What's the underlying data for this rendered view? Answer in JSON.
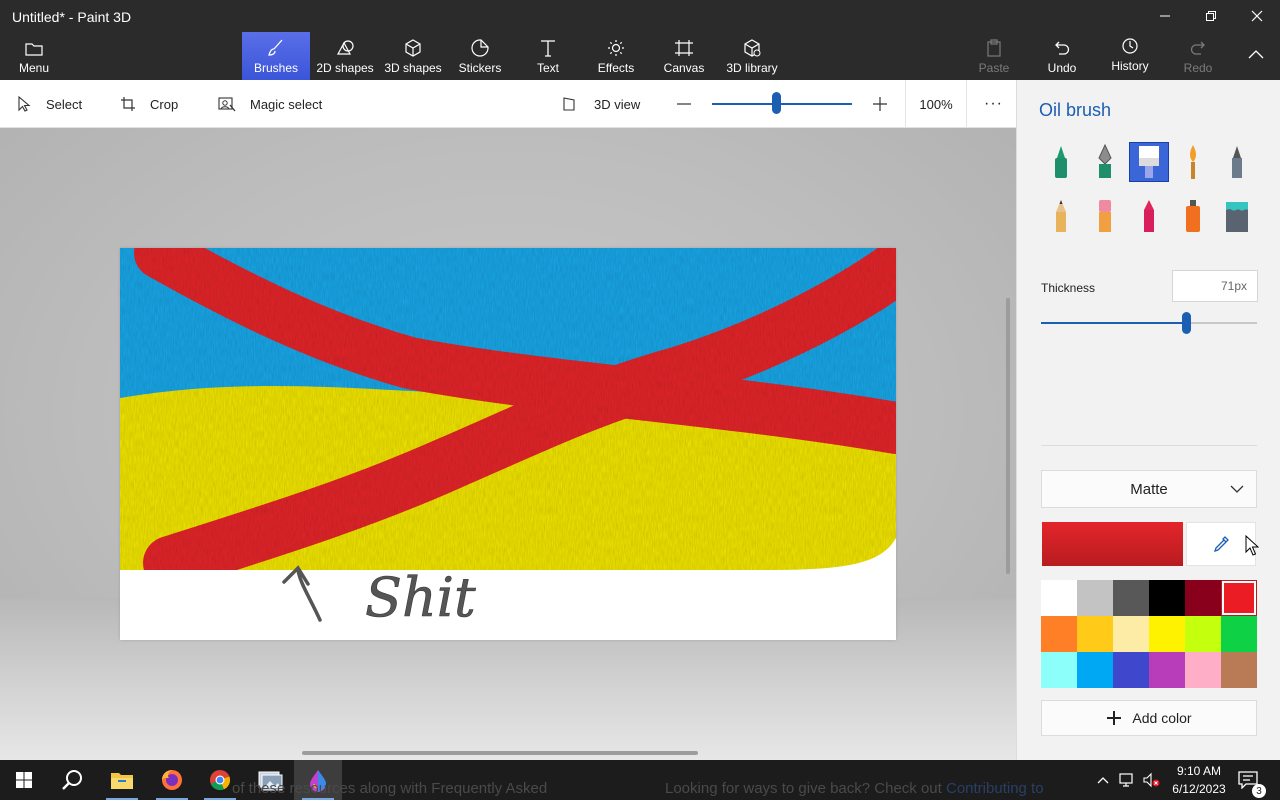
{
  "window": {
    "title": "Untitled* - Paint 3D",
    "minimize_icon": "minimize-icon",
    "maximize_icon": "restore-icon",
    "close_icon": "close-icon"
  },
  "ribbon": {
    "menu_label": "Menu",
    "tabs": [
      {
        "label": "Brushes",
        "icon": "brush-icon",
        "active": true
      },
      {
        "label": "2D shapes",
        "icon": "2d-shapes-icon"
      },
      {
        "label": "3D shapes",
        "icon": "cube-icon"
      },
      {
        "label": "Stickers",
        "icon": "sticker-icon"
      },
      {
        "label": "Text",
        "icon": "text-icon"
      },
      {
        "label": "Effects",
        "icon": "sun-icon"
      },
      {
        "label": "Canvas",
        "icon": "canvas-icon"
      },
      {
        "label": "3D library",
        "icon": "library-icon"
      }
    ],
    "actions": [
      {
        "label": "Paste",
        "icon": "paste-icon",
        "enabled": false
      },
      {
        "label": "Undo",
        "icon": "undo-icon",
        "enabled": true
      },
      {
        "label": "History",
        "icon": "history-icon",
        "enabled": true
      },
      {
        "label": "Redo",
        "icon": "redo-icon",
        "enabled": false
      }
    ],
    "collapse_icon": "chevron-up-icon"
  },
  "toolbar": {
    "select_label": "Select",
    "crop_label": "Crop",
    "magic_select_label": "Magic select",
    "view3d_label": "3D view",
    "zoom_value": "100%",
    "zoom_level": 0.46,
    "more_label": "···"
  },
  "canvas": {
    "annotation_text": "Shit",
    "colors": {
      "sky": "#1ba7e8",
      "sun": "#f2e600",
      "stroke": "#e4252b",
      "ink": "#555555"
    }
  },
  "panel": {
    "title": "Oil brush",
    "brushes": [
      {
        "name": "marker",
        "icon": "marker-icon"
      },
      {
        "name": "calligraphy pen",
        "icon": "calligraphy-pen-icon"
      },
      {
        "name": "oil brush",
        "icon": "oil-brush-icon",
        "selected": true
      },
      {
        "name": "watercolor",
        "icon": "watercolor-icon"
      },
      {
        "name": "pixel pen",
        "icon": "pixel-pen-icon"
      },
      {
        "name": "pencil",
        "icon": "pencil-icon"
      },
      {
        "name": "eraser",
        "icon": "eraser-icon"
      },
      {
        "name": "crayon",
        "icon": "crayon-icon"
      },
      {
        "name": "spray can",
        "icon": "spray-can-icon"
      },
      {
        "name": "fill",
        "icon": "fill-bucket-icon"
      }
    ],
    "thickness_label": "Thickness",
    "thickness_value": "71px",
    "thickness_level": 0.67,
    "finish_label": "Matte",
    "current_color": "#e4252b",
    "eyedropper_icon": "eyedropper-icon",
    "palette": [
      "#ffffff",
      "#c3c3c3",
      "#585858",
      "#000000",
      "#88001b",
      "#ec1c24",
      "#ff7f27",
      "#ffca18",
      "#fdeca6",
      "#fff200",
      "#c4ff0e",
      "#0ed145",
      "#8cfffb",
      "#00a8f3",
      "#3f48cc",
      "#b83dba",
      "#ffaec8",
      "#b97a56"
    ],
    "add_color_label": "Add color"
  },
  "taskbar": {
    "apps": [
      {
        "name": "start",
        "icon": "windows-logo-icon"
      },
      {
        "name": "search",
        "icon": "search-icon"
      },
      {
        "name": "file-explorer",
        "icon": "folder-icon"
      },
      {
        "name": "firefox",
        "icon": "firefox-icon"
      },
      {
        "name": "chrome",
        "icon": "chrome-icon"
      },
      {
        "name": "photos",
        "icon": "photos-icon"
      },
      {
        "name": "paint-3d",
        "icon": "paint-3d-icon",
        "active": true
      }
    ],
    "background_text_left": "of these resources along with Frequently Asked",
    "background_text_right_plain": "Looking for ways to give back? Check out ",
    "background_text_right_link": "Contributing to",
    "time": "9:10 AM",
    "date": "6/12/2023",
    "notification_count": "3"
  }
}
